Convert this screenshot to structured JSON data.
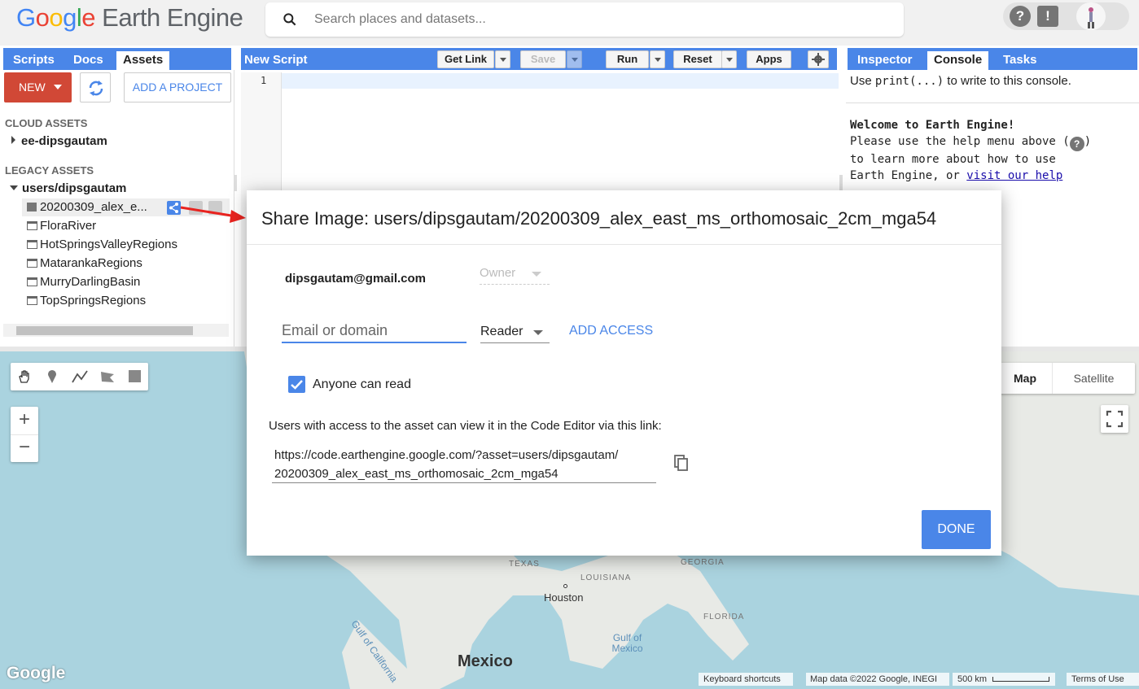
{
  "header": {
    "logo_google": "Google",
    "logo_product": "Earth Engine",
    "search_placeholder": "Search places and datasets...",
    "help_icon": "?",
    "feedback_icon": "!"
  },
  "left_panel": {
    "tabs": [
      "Scripts",
      "Docs",
      "Assets"
    ],
    "active_tab": "Assets",
    "new_label": "NEW",
    "add_project_label": "ADD A PROJECT",
    "cloud_assets_label": "CLOUD ASSETS",
    "cloud_project": "ee-dipsgautam",
    "legacy_assets_label": "LEGACY ASSETS",
    "legacy_root": "users/dipsgautam",
    "assets": [
      {
        "name": "20200309_alex_e...",
        "icon": "image-icon"
      },
      {
        "name": "FloraRiver",
        "icon": "table-icon"
      },
      {
        "name": "HotSpringsValleyRegions",
        "icon": "table-icon"
      },
      {
        "name": "MatarankaRegions",
        "icon": "table-icon"
      },
      {
        "name": "MurryDarlingBasin",
        "icon": "table-icon"
      },
      {
        "name": "TopSpringsRegions",
        "icon": "table-icon"
      }
    ]
  },
  "center_panel": {
    "title": "New Script",
    "get_link": "Get Link",
    "save": "Save",
    "run": "Run",
    "reset": "Reset",
    "apps": "Apps",
    "line_number": "1"
  },
  "right_panel": {
    "tabs": [
      "Inspector",
      "Console",
      "Tasks"
    ],
    "active_tab": "Console",
    "hint_prefix": "Use ",
    "hint_code": "print(...)",
    "hint_suffix": " to write to this console.",
    "welcome_title": "Welcome to Earth Engine!",
    "welcome_line1": "Please use the help menu above (",
    "welcome_line2": "to learn more about how to use",
    "welcome_line3_prefix": "Earth Engine, or ",
    "welcome_link": "visit our help"
  },
  "map": {
    "map_type": "Map",
    "satellite": "Satellite",
    "labels": {
      "texas": "TEXAS",
      "louisiana": "LOUISIANA",
      "georgia": "GEORGIA",
      "florida": "FLORIDA",
      "houston": "Houston",
      "gulf_mexico": "Gulf of\nMexico",
      "gulf_california": "Gulf of California",
      "mexico": "Mexico"
    },
    "watermark": "Google",
    "keyboard_shortcuts": "Keyboard shortcuts",
    "map_data": "Map data ©2022 Google, INEGI",
    "scale": "500 km",
    "terms": "Terms of Use"
  },
  "dialog": {
    "title": "Share Image: users/dipsgautam/20200309_alex_east_ms_orthomosaic_2cm_mga54",
    "owner_email": "dipsgautam@gmail.com",
    "owner_role": "Owner",
    "email_placeholder": "Email or domain",
    "role": "Reader",
    "add_access": "ADD ACCESS",
    "anyone_can_read": "Anyone can read",
    "anyone_checked": true,
    "link_hint": "Users with access to the asset can view it in the Code Editor via this link:",
    "link_line1": "https://code.earthengine.google.com/?asset=users/dipsgautam/",
    "link_line2": "20200309_alex_east_ms_orthomosaic_2cm_mga54",
    "done": "DONE"
  },
  "colors": {
    "accent_blue": "#4a86e8",
    "new_red": "#d14836",
    "arrow_red": "#e8231f",
    "map_water": "#aad3df",
    "map_land": "#e8eae6"
  }
}
